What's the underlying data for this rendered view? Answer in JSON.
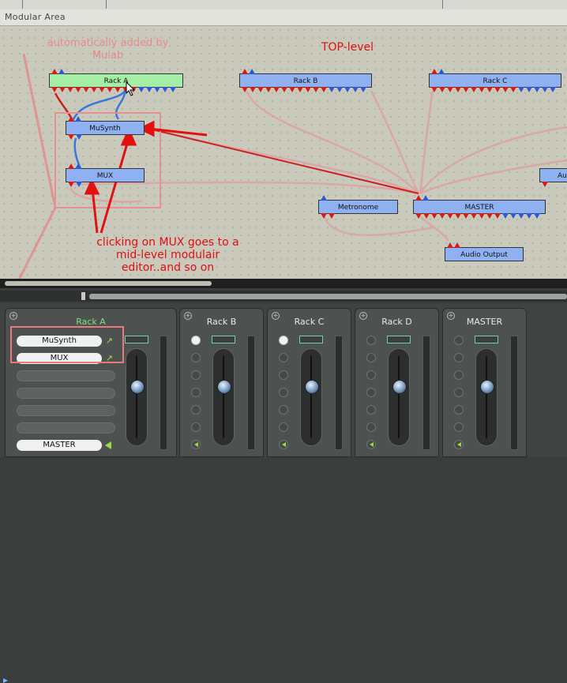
{
  "area": {
    "title": "Modular Area"
  },
  "modules": {
    "rack_a": "Rack A",
    "rack_b": "Rack B",
    "rack_c": "Rack C",
    "musynth": "MuSynth",
    "mux": "MUX",
    "rack_partial": "Au",
    "metronome": "Metronome",
    "master": "MASTER",
    "audio_output": "Audio Output"
  },
  "annotations": {
    "auto_added": "automatically added by Mulab",
    "top_level": "TOP-level",
    "mux_note": "clicking on MUX  goes to a mid-level modulair editor..and so on"
  },
  "mixer": {
    "strips": [
      {
        "title": "Rack  A",
        "slots": [
          "MuSynth",
          "MUX"
        ],
        "output": "MASTER"
      },
      {
        "title": "Rack  B"
      },
      {
        "title": "Rack  C"
      },
      {
        "title": "Rack  D"
      },
      {
        "title": "MASTER"
      }
    ]
  },
  "colors": {
    "module_blue": "#8fb1f2",
    "module_green": "#a5eea5",
    "annotation_red": "#e01010",
    "wire_pink": "#e2a0a0"
  },
  "icons": {
    "cursor": "arrow-cursor-icon",
    "add": "plus-circle-icon",
    "route": "route-arrow-icon",
    "speaker": "speaker-icon"
  }
}
